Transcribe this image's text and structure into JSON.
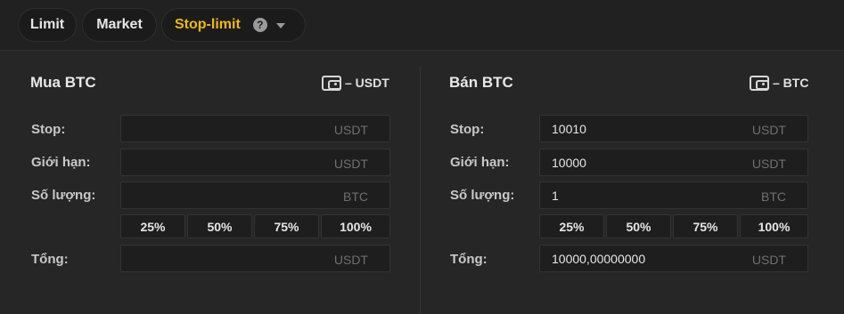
{
  "order_types": {
    "limit": "Limit",
    "market": "Market",
    "stop_limit": "Stop-limit",
    "help": "?"
  },
  "colors": {
    "accent": "#f0b90b"
  },
  "buy": {
    "title": "Mua BTC",
    "balance": "– USDT",
    "stop": {
      "label": "Stop:",
      "value": "",
      "unit": "USDT"
    },
    "limit": {
      "label": "Giới hạn:",
      "value": "",
      "unit": "USDT"
    },
    "amount": {
      "label": "Số lượng:",
      "value": "",
      "unit": "BTC"
    },
    "percents": [
      "25%",
      "50%",
      "75%",
      "100%"
    ],
    "total": {
      "label": "Tổng:",
      "value": "",
      "unit": "USDT"
    }
  },
  "sell": {
    "title": "Bán BTC",
    "balance": "– BTC",
    "stop": {
      "label": "Stop:",
      "value": "10010",
      "unit": "USDT"
    },
    "limit": {
      "label": "Giới hạn:",
      "value": "10000",
      "unit": "USDT"
    },
    "amount": {
      "label": "Số lượng:",
      "value": "1",
      "unit": "BTC"
    },
    "percents": [
      "25%",
      "50%",
      "75%",
      "100%"
    ],
    "total": {
      "label": "Tổng:",
      "value": "10000,00000000",
      "unit": "USDT"
    }
  }
}
